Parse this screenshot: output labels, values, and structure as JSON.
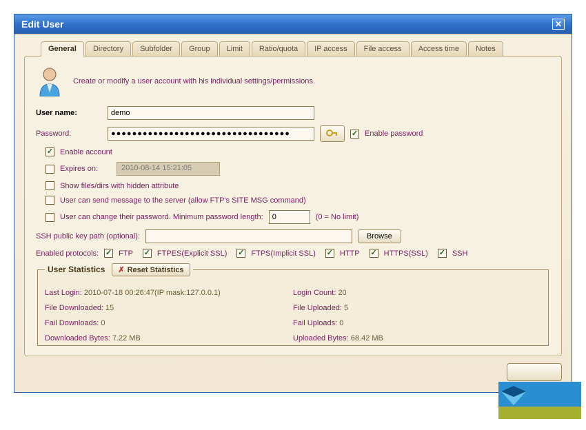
{
  "window": {
    "title": "Edit User"
  },
  "tabs": [
    {
      "label": "General",
      "name": "tab-general",
      "active": true
    },
    {
      "label": "Directory",
      "name": "tab-directory",
      "active": false
    },
    {
      "label": "Subfolder",
      "name": "tab-subfolder",
      "active": false
    },
    {
      "label": "Group",
      "name": "tab-group",
      "active": false
    },
    {
      "label": "Limit",
      "name": "tab-limit",
      "active": false
    },
    {
      "label": "Ratio/quota",
      "name": "tab-ratio-quota",
      "active": false
    },
    {
      "label": "IP access",
      "name": "tab-ip-access",
      "active": false
    },
    {
      "label": "File access",
      "name": "tab-file-access",
      "active": false
    },
    {
      "label": "Access time",
      "name": "tab-access-time",
      "active": false
    },
    {
      "label": "Notes",
      "name": "tab-notes",
      "active": false
    }
  ],
  "intro": "Create or modify a user account with his individual settings/permissions.",
  "fields": {
    "username_label": "User name:",
    "username_value": "demo",
    "password_label": "Password:",
    "password_value": "●●●●●●●●●●●●●●●●●●●●●●●●●●●●●●●●●●",
    "enable_password_label": "Enable password",
    "enable_password_checked": true,
    "enable_account_label": "Enable account",
    "enable_account_checked": true,
    "expires_label": "Expires on:",
    "expires_checked": false,
    "expires_value": "2010-08-14 15:21:05",
    "show_hidden_label": "Show files/dirs with hidden attribute",
    "show_hidden_checked": false,
    "send_msg_label": "User can send message to the server (allow FTP's SITE MSG command)",
    "send_msg_checked": false,
    "change_pw_label": "User can change their password. Minimum password length:",
    "change_pw_checked": false,
    "min_pw_len": "0",
    "min_pw_hint": "(0 = No limit)",
    "ssh_key_label": "SSH public key path (optional):",
    "ssh_key_value": "",
    "browse_label": "Browse",
    "protocols_label": "Enabled protocols:"
  },
  "protocols": [
    {
      "label": "FTP",
      "name": "protocol-ftp",
      "checked": true
    },
    {
      "label": "FTPES(Explicit SSL)",
      "name": "protocol-ftpes",
      "checked": true
    },
    {
      "label": "FTPS(Implicit SSL)",
      "name": "protocol-ftps",
      "checked": true
    },
    {
      "label": "HTTP",
      "name": "protocol-http",
      "checked": true
    },
    {
      "label": "HTTPS(SSL)",
      "name": "protocol-https",
      "checked": true
    },
    {
      "label": "SSH",
      "name": "protocol-ssh",
      "checked": true
    }
  ],
  "stats": {
    "legend": "User Statistics",
    "reset_label": "Reset Statistics",
    "last_login_label": "Last Login: ",
    "last_login_value": "2010-07-18 00:26:47(IP mask:127.0.0.1)",
    "login_count_label": "Login Count: ",
    "login_count_value": "20",
    "file_dl_label": "File Downloaded: ",
    "file_dl_value": "15",
    "file_ul_label": "File Uploaded: ",
    "file_ul_value": "5",
    "fail_dl_label": "Fail Downloads: ",
    "fail_dl_value": "0",
    "fail_ul_label": "Fail Uploads: ",
    "fail_ul_value": "0",
    "dl_bytes_label": "Downloaded Bytes: ",
    "dl_bytes_value": "7.22 MB",
    "ul_bytes_label": "Uploaded Bytes: ",
    "ul_bytes_value": "68.42 MB"
  }
}
